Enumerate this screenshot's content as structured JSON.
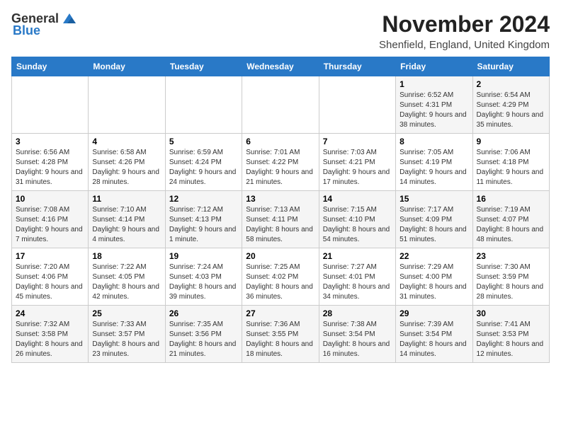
{
  "logo": {
    "general": "General",
    "blue": "Blue"
  },
  "header": {
    "title": "November 2024",
    "subtitle": "Shenfield, England, United Kingdom"
  },
  "weekdays": [
    "Sunday",
    "Monday",
    "Tuesday",
    "Wednesday",
    "Thursday",
    "Friday",
    "Saturday"
  ],
  "weeks": [
    [
      {
        "day": "",
        "info": ""
      },
      {
        "day": "",
        "info": ""
      },
      {
        "day": "",
        "info": ""
      },
      {
        "day": "",
        "info": ""
      },
      {
        "day": "",
        "info": ""
      },
      {
        "day": "1",
        "info": "Sunrise: 6:52 AM\nSunset: 4:31 PM\nDaylight: 9 hours and 38 minutes."
      },
      {
        "day": "2",
        "info": "Sunrise: 6:54 AM\nSunset: 4:29 PM\nDaylight: 9 hours and 35 minutes."
      }
    ],
    [
      {
        "day": "3",
        "info": "Sunrise: 6:56 AM\nSunset: 4:28 PM\nDaylight: 9 hours and 31 minutes."
      },
      {
        "day": "4",
        "info": "Sunrise: 6:58 AM\nSunset: 4:26 PM\nDaylight: 9 hours and 28 minutes."
      },
      {
        "day": "5",
        "info": "Sunrise: 6:59 AM\nSunset: 4:24 PM\nDaylight: 9 hours and 24 minutes."
      },
      {
        "day": "6",
        "info": "Sunrise: 7:01 AM\nSunset: 4:22 PM\nDaylight: 9 hours and 21 minutes."
      },
      {
        "day": "7",
        "info": "Sunrise: 7:03 AM\nSunset: 4:21 PM\nDaylight: 9 hours and 17 minutes."
      },
      {
        "day": "8",
        "info": "Sunrise: 7:05 AM\nSunset: 4:19 PM\nDaylight: 9 hours and 14 minutes."
      },
      {
        "day": "9",
        "info": "Sunrise: 7:06 AM\nSunset: 4:18 PM\nDaylight: 9 hours and 11 minutes."
      }
    ],
    [
      {
        "day": "10",
        "info": "Sunrise: 7:08 AM\nSunset: 4:16 PM\nDaylight: 9 hours and 7 minutes."
      },
      {
        "day": "11",
        "info": "Sunrise: 7:10 AM\nSunset: 4:14 PM\nDaylight: 9 hours and 4 minutes."
      },
      {
        "day": "12",
        "info": "Sunrise: 7:12 AM\nSunset: 4:13 PM\nDaylight: 9 hours and 1 minute."
      },
      {
        "day": "13",
        "info": "Sunrise: 7:13 AM\nSunset: 4:11 PM\nDaylight: 8 hours and 58 minutes."
      },
      {
        "day": "14",
        "info": "Sunrise: 7:15 AM\nSunset: 4:10 PM\nDaylight: 8 hours and 54 minutes."
      },
      {
        "day": "15",
        "info": "Sunrise: 7:17 AM\nSunset: 4:09 PM\nDaylight: 8 hours and 51 minutes."
      },
      {
        "day": "16",
        "info": "Sunrise: 7:19 AM\nSunset: 4:07 PM\nDaylight: 8 hours and 48 minutes."
      }
    ],
    [
      {
        "day": "17",
        "info": "Sunrise: 7:20 AM\nSunset: 4:06 PM\nDaylight: 8 hours and 45 minutes."
      },
      {
        "day": "18",
        "info": "Sunrise: 7:22 AM\nSunset: 4:05 PM\nDaylight: 8 hours and 42 minutes."
      },
      {
        "day": "19",
        "info": "Sunrise: 7:24 AM\nSunset: 4:03 PM\nDaylight: 8 hours and 39 minutes."
      },
      {
        "day": "20",
        "info": "Sunrise: 7:25 AM\nSunset: 4:02 PM\nDaylight: 8 hours and 36 minutes."
      },
      {
        "day": "21",
        "info": "Sunrise: 7:27 AM\nSunset: 4:01 PM\nDaylight: 8 hours and 34 minutes."
      },
      {
        "day": "22",
        "info": "Sunrise: 7:29 AM\nSunset: 4:00 PM\nDaylight: 8 hours and 31 minutes."
      },
      {
        "day": "23",
        "info": "Sunrise: 7:30 AM\nSunset: 3:59 PM\nDaylight: 8 hours and 28 minutes."
      }
    ],
    [
      {
        "day": "24",
        "info": "Sunrise: 7:32 AM\nSunset: 3:58 PM\nDaylight: 8 hours and 26 minutes."
      },
      {
        "day": "25",
        "info": "Sunrise: 7:33 AM\nSunset: 3:57 PM\nDaylight: 8 hours and 23 minutes."
      },
      {
        "day": "26",
        "info": "Sunrise: 7:35 AM\nSunset: 3:56 PM\nDaylight: 8 hours and 21 minutes."
      },
      {
        "day": "27",
        "info": "Sunrise: 7:36 AM\nSunset: 3:55 PM\nDaylight: 8 hours and 18 minutes."
      },
      {
        "day": "28",
        "info": "Sunrise: 7:38 AM\nSunset: 3:54 PM\nDaylight: 8 hours and 16 minutes."
      },
      {
        "day": "29",
        "info": "Sunrise: 7:39 AM\nSunset: 3:54 PM\nDaylight: 8 hours and 14 minutes."
      },
      {
        "day": "30",
        "info": "Sunrise: 7:41 AM\nSunset: 3:53 PM\nDaylight: 8 hours and 12 minutes."
      }
    ]
  ]
}
